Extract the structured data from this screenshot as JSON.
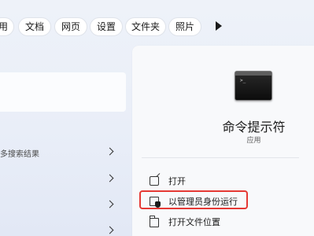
{
  "filter_tabs": [
    "用",
    "文档",
    "网页",
    "设置",
    "文件夹",
    "照片"
  ],
  "more_results_label": "多搜索结果",
  "app": {
    "name": "命令提示符",
    "type": "应用"
  },
  "actions": [
    {
      "label": "打开",
      "icon": "open-external-icon"
    },
    {
      "label": "以管理员身份运行",
      "icon": "admin-shield-icon"
    },
    {
      "label": "打开文件位置",
      "icon": "folder-icon"
    }
  ],
  "colors": {
    "highlight": "#e53935",
    "panel": "#f8f9fb",
    "background": "#eef2f9"
  }
}
